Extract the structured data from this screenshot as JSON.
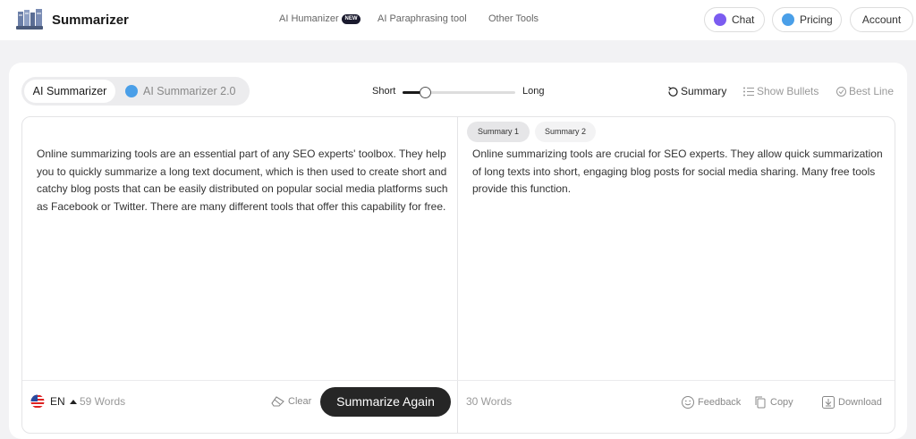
{
  "header": {
    "brand": "Summarizer",
    "nav": [
      {
        "label": "AI Humanizer",
        "badge": "NEW"
      },
      {
        "label": "AI Paraphrasing tool"
      },
      {
        "label": "Other Tools"
      }
    ],
    "chat_label": "Chat",
    "pricing_label": "Pricing",
    "account_label": "Account"
  },
  "modes": {
    "active": "AI Summarizer",
    "inactive": "AI Summarizer 2.0"
  },
  "length": {
    "short_label": "Short",
    "long_label": "Long",
    "value": 0.2
  },
  "view_options": {
    "summary": "Summary",
    "bullets": "Show Bullets",
    "best_line": "Best Line"
  },
  "input": {
    "text": "Online summarizing tools are an essential part of any SEO experts' toolbox. They help you to quickly summarize a long text document, which is then used to create short and catchy blog posts that can be easily distributed on popular social media platforms such as Facebook or Twitter. There are many different tools that offer this capability for free.",
    "language": "EN",
    "word_count": "59 Words",
    "clear_label": "Clear",
    "summarize_label": "Summarize Again"
  },
  "output": {
    "tabs": [
      "Summary 1",
      "Summary 2"
    ],
    "text": "Online summarizing tools are crucial for SEO experts. They allow quick summarization of long texts into short, engaging blog posts for social media sharing. Many free tools provide this function.",
    "word_count": "30 Words",
    "feedback_label": "Feedback",
    "copy_label": "Copy",
    "download_label": "Download"
  },
  "colors": {
    "chat_dot": "#7b5cf0",
    "pricing_dot": "#4a9fe8",
    "primary_button": "#262626"
  }
}
